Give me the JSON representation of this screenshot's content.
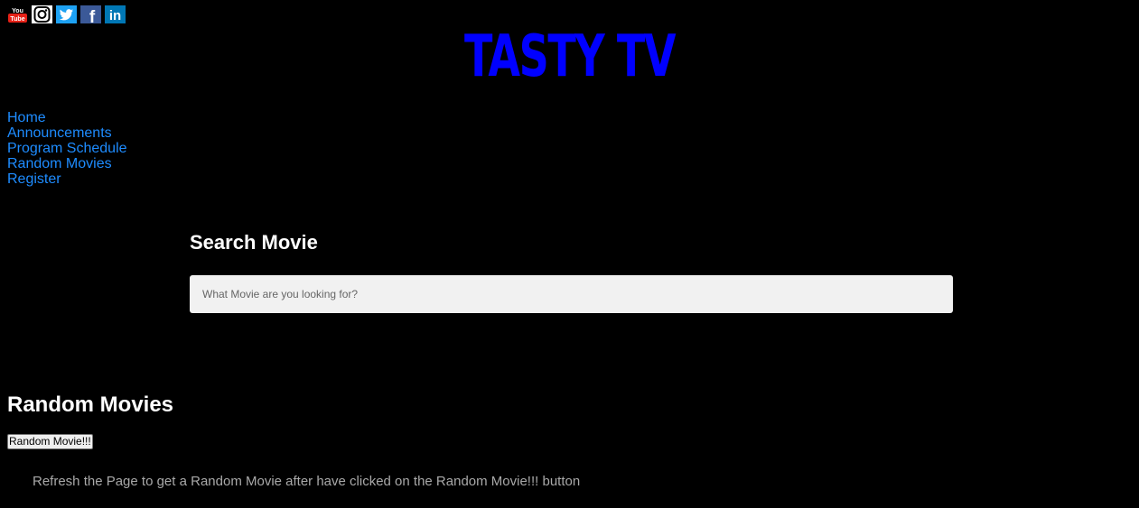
{
  "social": {
    "youtube": {
      "icon": "youtube-icon",
      "top_text": "You",
      "bottom_text": "Tube",
      "color": "#e62117"
    },
    "instagram": {
      "icon": "instagram-icon",
      "color": "#ffffff"
    },
    "twitter": {
      "icon": "twitter-icon",
      "color": "#1da1f2"
    },
    "facebook": {
      "icon": "facebook-icon",
      "text": "f",
      "color": "#3b5998"
    },
    "linkedin": {
      "icon": "linkedin-icon",
      "text": "in",
      "color": "#0077b5"
    }
  },
  "header": {
    "title": "TASTY TV",
    "title_color": "#0000ff"
  },
  "nav": {
    "items": [
      {
        "label": "Home"
      },
      {
        "label": "Announcements"
      },
      {
        "label": "Program Schedule"
      },
      {
        "label": "Random Movies"
      },
      {
        "label": "Register"
      }
    ],
    "link_color": "#1e8cff"
  },
  "search": {
    "heading": "Search Movie",
    "placeholder": "What Movie are you looking for?",
    "value": ""
  },
  "random": {
    "heading": "Random Movies",
    "button_label": "Random Movie!!!",
    "note": "Refresh the Page to get a Random Movie after have clicked on the Random Movie!!! button"
  }
}
